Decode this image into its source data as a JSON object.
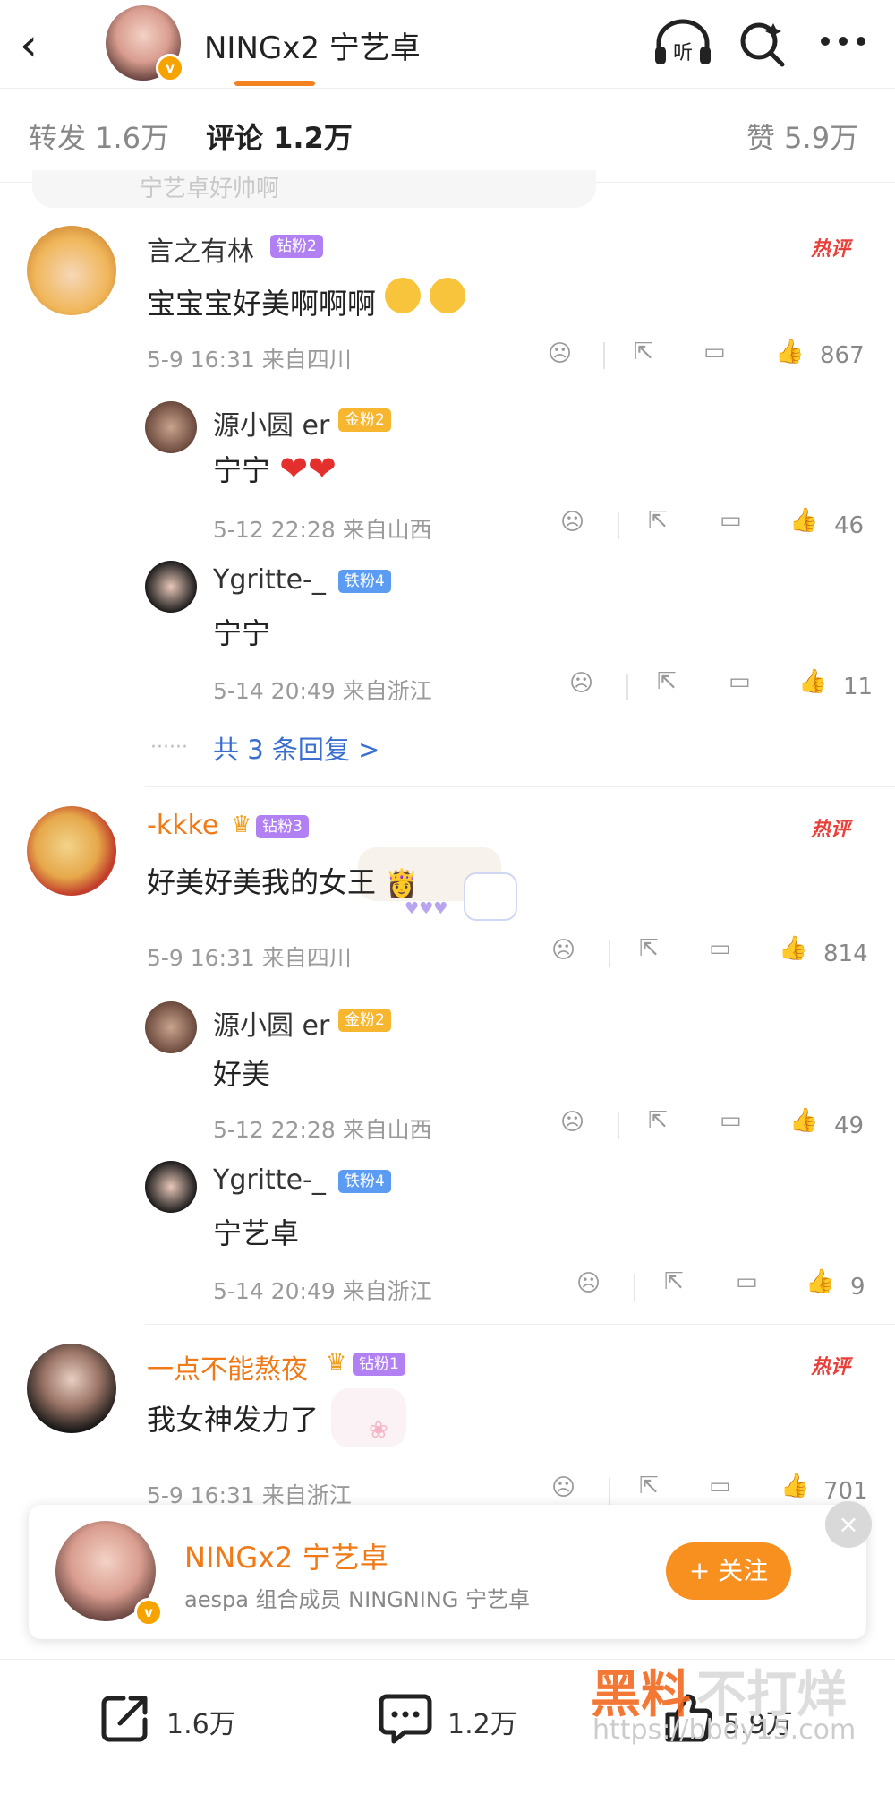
{
  "header": {
    "back": "‹",
    "name": "NINGx2 宁艺卓",
    "badge": "v",
    "listen_label": "听"
  },
  "tabs": {
    "repost": "转发 1.6万",
    "comments": "评论 1.2万",
    "likes": "赞 5.9万"
  },
  "ghost_text": "宁艺卓好帅啊",
  "comments": [
    {
      "user": "言之有林",
      "fan": "钻粉2",
      "hot": "热评",
      "text": "宝宝宝好美啊啊啊",
      "meta": "5-9 16:31 来自四川",
      "likes": "867",
      "replies": [
        {
          "user": "源小圆 er",
          "fan": "金粉2",
          "text": "宁宁",
          "meta": "5-12 22:28 来自山西",
          "likes": "46"
        },
        {
          "user": "Ygritte-_",
          "fan": "铁粉4",
          "text": "宁宁",
          "meta": "5-14 20:49 来自浙江",
          "likes": "11"
        }
      ],
      "more": "共 3 条回复 >"
    },
    {
      "user": "-kkke",
      "fan": "钻粉3",
      "hot": "热评",
      "text": "好美好美我的女王",
      "meta": "5-9 16:31 来自四川",
      "likes": "814",
      "replies": [
        {
          "user": "源小圆 er",
          "fan": "金粉2",
          "text": "好美",
          "meta": "5-12 22:28 来自山西",
          "likes": "49"
        },
        {
          "user": "Ygritte-_",
          "fan": "铁粉4",
          "text": "宁艺卓",
          "meta": "5-14 20:49 来自浙江",
          "likes": "9"
        }
      ]
    },
    {
      "user": "一点不能熬夜",
      "fan": "钻粉1",
      "hot": "热评",
      "text": "我女神发力了",
      "meta": "5-9 16:31 来自浙江",
      "likes": "701"
    }
  ],
  "popup": {
    "name": "NINGx2 宁艺卓",
    "desc": "aespa 组合成员 NINGNING 宁艺卓",
    "follow": "+ 关注",
    "close": "×"
  },
  "bottom": {
    "repost": "1.6万",
    "comment": "1.2万",
    "like": "5.9万"
  },
  "watermark": {
    "line1a": "黑料",
    "line1b": "不打烊",
    "line2": "https://bbdy15.com"
  },
  "colors": {
    "accent": "#f58220",
    "link": "#3b6fcf",
    "hot": "#e8403a"
  }
}
